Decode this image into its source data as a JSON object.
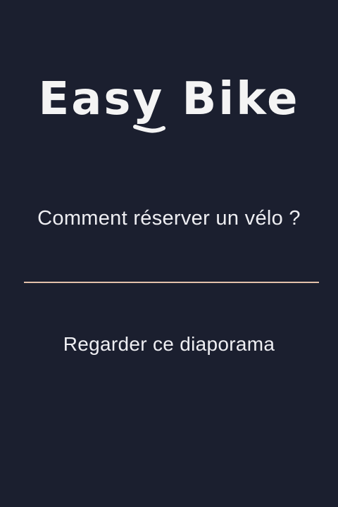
{
  "app": {
    "logo_text": "Easy Bike"
  },
  "main": {
    "question": "Comment réserver un vélo ?",
    "cta_label": "Regarder ce diaporama"
  },
  "colors": {
    "background": "#1b1f2f",
    "text": "#eeeef2",
    "divider": "#e3c1aa"
  }
}
